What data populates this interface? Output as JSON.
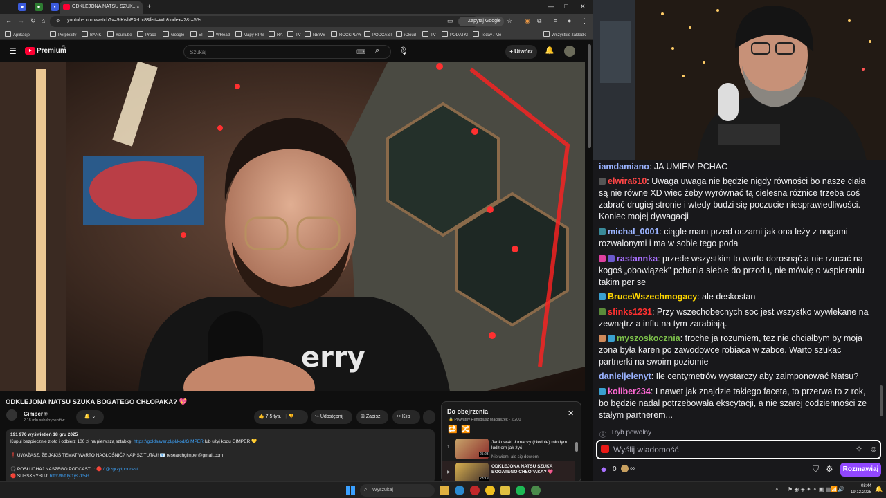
{
  "browser": {
    "tab_title": "ODKLEJONA NATSU SZUK...",
    "url": "youtube.com/watch?v=9lKwbEA-Uc8&list=WL&index=2&t=55s",
    "ask_google": "Zapytaj Google",
    "bookmarks": [
      "Aplikacje",
      "Perplexity",
      "BANK",
      "YouTube",
      "Praca",
      "Google",
      "EI",
      "WHead",
      "Mapy RPG",
      "RA",
      "TV",
      "NEWS",
      "ROCKPLAY",
      "PODCAST",
      "iCloud",
      "TV",
      "PODATKI",
      "Today / Me"
    ],
    "all_bookmarks": "Wszystkie zakładki"
  },
  "youtube": {
    "logo": "Premium",
    "logo_sup": "PL",
    "search_placeholder": "Szukaj",
    "create_label": "Utwórz",
    "video_title": "ODKLEJONA NATSU SZUKA BOGATEGO CHŁOPAKA? 💖",
    "channel_name": "Gimper",
    "channel_subs": "2,18 mln subskrybentów",
    "likes": "7,5 tys.",
    "share": "Udostępnij",
    "save": "Zapisz",
    "clip": "Klip",
    "description": {
      "stats": "191 970 wyświetleń  18 gru 2025",
      "line1a": "Kupuj bezpiecznie złoto i odbierz 100 zł na pierwszą sztabkę: ",
      "line1_link": "https://goldsaver.pl/pl/kod/GIMPER",
      "line1b": " lub użyj kodu GIMPER 💛",
      "line2": "❗ UWAŻASZ, ŻE JAKIŚ TEMAT WARTO NAGŁOŚNIĆ? NAPISZ TUTAJ! 📧 researchgimper@gmail.com",
      "line3a": "🎧 POSŁUCHAJ NASZEGO PODCASTU: ",
      "line3b": "🔴 / @zgrzytpodcast",
      "line4a": "🔴 SUBSKRYBUJ: ",
      "line4_link": "http://bit.ly/1ys7k5G"
    },
    "queue": {
      "title": "Do obejrzenia",
      "privacy": "Prywatny",
      "owner": "Remigiusz Maciaszek",
      "position": "2/200",
      "items": [
        {
          "index": "1",
          "title": "Jankowski tłumaczy (błędnie) młodym ludziom jak żyć",
          "sub": "Nie wiem, ale się dowiem!",
          "duration": "25:23"
        },
        {
          "index": "▶",
          "title": "ODKLEJONA NATSU SZUKA BOGATEGO CHŁOPAKA? 💖",
          "sub": "Gimper",
          "duration": "23:19"
        }
      ]
    }
  },
  "chat": {
    "messages": [
      {
        "user": "iamdamiano",
        "color": "#9ab3ff",
        "text": ": JA UMIEM PCHAC"
      },
      {
        "user": "elwira610",
        "color": "#ff4545",
        "text": ": Uwaga uwaga nie będzie nigdy równości bo nasze ciała są nie równe XD wiec żeby wyrównać tą cielesna różnice trzeba coś zabrać drugiej stronie i wtedy budzi się poczucie niesprawiedliwości. Koniec mojej dywagacji"
      },
      {
        "user": "michal_0001",
        "color": "#9ab3ff",
        "text": ": ciągle mam przed oczami jak ona leży z nogami rozwalonymi i ma w sobie tego poda"
      },
      {
        "user": "rastannka",
        "color": "#a970ff",
        "text": ": przede wszystkim to warto dorosnąć a nie rzucać na kogoś „obowiązek\" pchania siebie do przodu, nie mówię o wspieraniu takim per se"
      },
      {
        "user": "BruceWszechmogacy",
        "color": "#ffd700",
        "text": ": ale deskostan"
      },
      {
        "user": "sfinks1231",
        "color": "#ff3030",
        "text": ": Przy wszechobecnych soc jest wszystko wywlekane na zewnątrz a influ na tym zarabiają."
      },
      {
        "user": "myszoskocznia",
        "color": "#7cc04a",
        "text": ": troche ja rozumiem, tez nie chciałbym by moja zona była karen po zawodowce robiaca w zabce. Warto szukac partnerki na swoim poziomie"
      },
      {
        "user": "danieljelenyt",
        "color": "#9ab3ff",
        "text": ": Ile centymetrów wystarczy aby zaimponować Natsu?"
      },
      {
        "user": "koliber234",
        "color": "#ff69d4",
        "text": ": I nawet jak znajdzie takiego faceta, to przerwa to z rok, bo będzie nadal potrzebowała ekscytacji, a nie szarej codzienności ze stałym partnerem..."
      }
    ],
    "slow_mode": "Tryb powolny",
    "input_placeholder": "Wyślij wiadomość",
    "points": "0",
    "send_label": "Rozmawiaj"
  },
  "taskbar": {
    "search_placeholder": "Wyszukaj",
    "time": "08:44",
    "date": "19.12.2025"
  }
}
